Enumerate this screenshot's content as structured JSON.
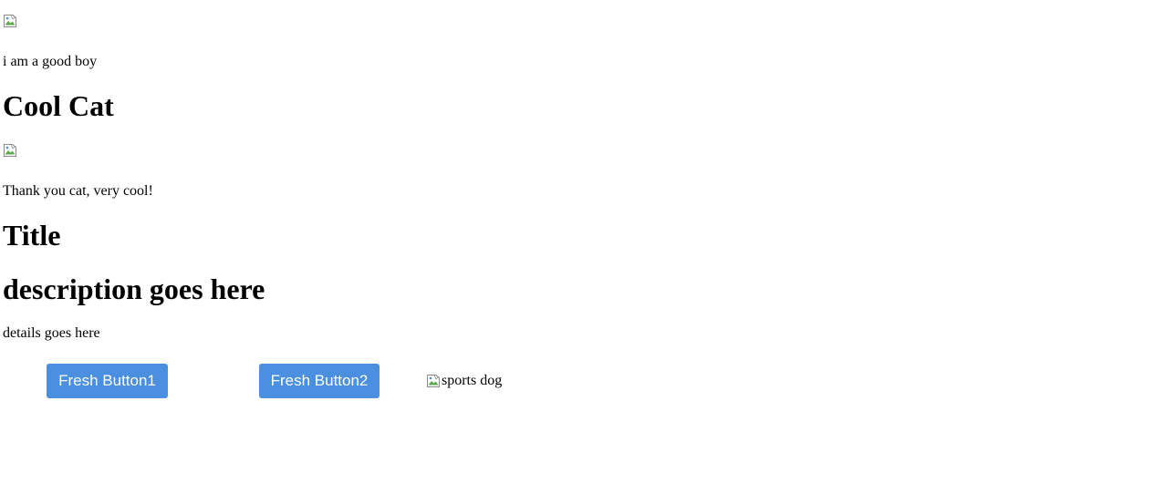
{
  "sections": [
    {
      "image_alt": "",
      "caption": "i am a good boy"
    },
    {
      "heading": "Cool Cat",
      "image_alt": "",
      "caption": "Thank you cat, very cool!"
    }
  ],
  "card": {
    "title": "Title",
    "description": "description goes here",
    "details": "details goes here"
  },
  "buttons": {
    "button1_label": "Fresh Button1",
    "button2_label": "Fresh Button2",
    "color": "#4a8fe0"
  },
  "dog_image": {
    "alt": "sports dog",
    "icon": "broken-image-icon"
  }
}
